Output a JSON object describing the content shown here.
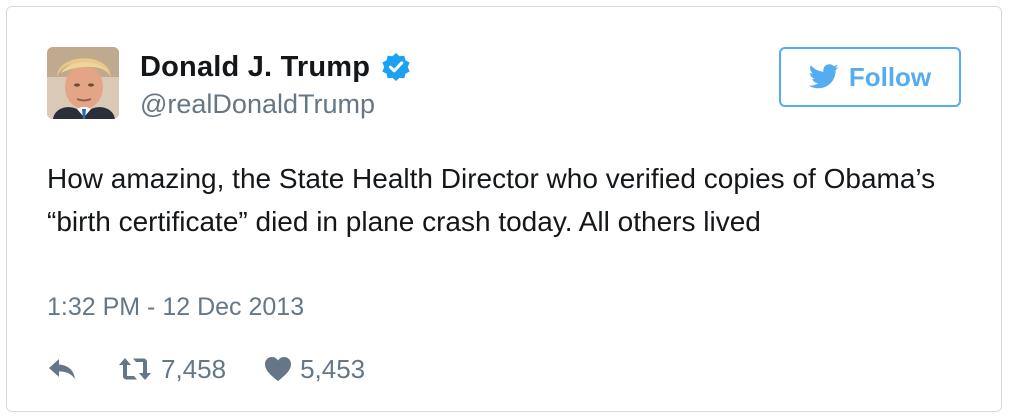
{
  "author": {
    "display_name": "Donald J. Trump",
    "handle": "@realDonaldTrump",
    "verified": true
  },
  "follow_button": {
    "label": "Follow",
    "icon": "twitter-bird-icon"
  },
  "tweet": {
    "text": "How amazing, the State Health Director who verified copies of Obama’s “birth certificate” died in plane crash today. All others lived",
    "timestamp": "1:32 PM - 12 Dec 2013"
  },
  "actions": {
    "reply_icon": "reply-icon",
    "retweet_icon": "retweet-icon",
    "retweet_count": "7,458",
    "like_icon": "heart-icon",
    "like_count": "5,453"
  },
  "colors": {
    "twitter_blue": "#55acee",
    "verified_blue": "#1da1f2",
    "text_primary": "#14171a",
    "text_secondary": "#657786",
    "border": "#d5dbe0"
  }
}
